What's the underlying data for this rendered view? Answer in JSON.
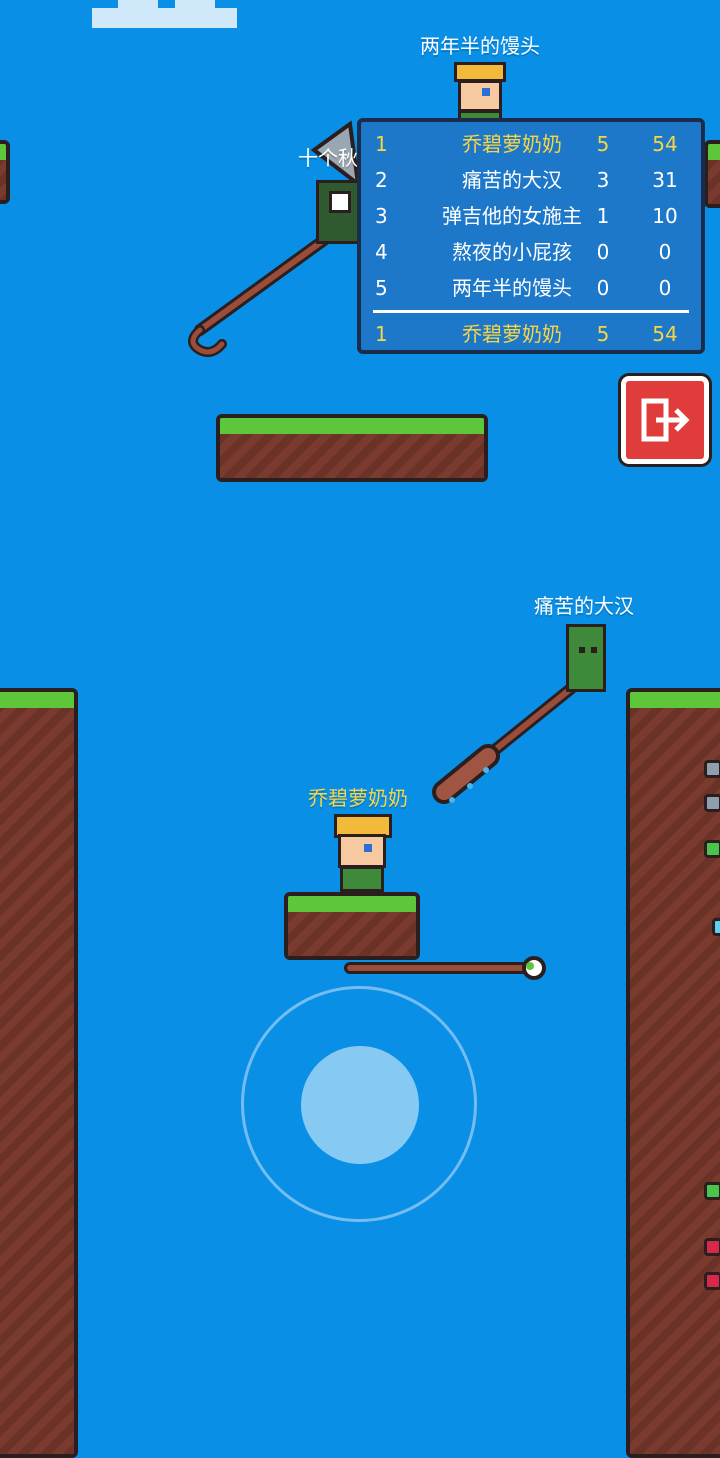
{
  "players": {
    "top": {
      "name": "两年半的馒头"
    },
    "partial": {
      "name": "十个秋"
    },
    "right": {
      "name": "痛苦的大汉"
    },
    "self": {
      "name": "乔碧萝奶奶"
    }
  },
  "leaderboard": {
    "rows": [
      {
        "rank": "1",
        "name": "乔碧萝奶奶",
        "kills": "5",
        "score": "54",
        "self": true
      },
      {
        "rank": "2",
        "name": "痛苦的大汉",
        "kills": "3",
        "score": "31"
      },
      {
        "rank": "3",
        "name": "弹吉他的女施主",
        "kills": "1",
        "score": "10"
      },
      {
        "rank": "4",
        "name": "熬夜的小屁孩",
        "kills": "0",
        "score": "0"
      },
      {
        "rank": "5",
        "name": "两年半的馒头",
        "kills": "0",
        "score": "0"
      }
    ],
    "self_row": {
      "rank": "1",
      "name": "乔碧萝奶奶",
      "kills": "5",
      "score": "54"
    }
  },
  "icons": {
    "exit": "exit-door-arrow-icon"
  },
  "colors": {
    "sky": "#0a8fe6",
    "self_name": "#f7d547",
    "exit_button": "#e03c3c",
    "grass": "#5dc63a",
    "dirt": "#7a3a2e"
  }
}
